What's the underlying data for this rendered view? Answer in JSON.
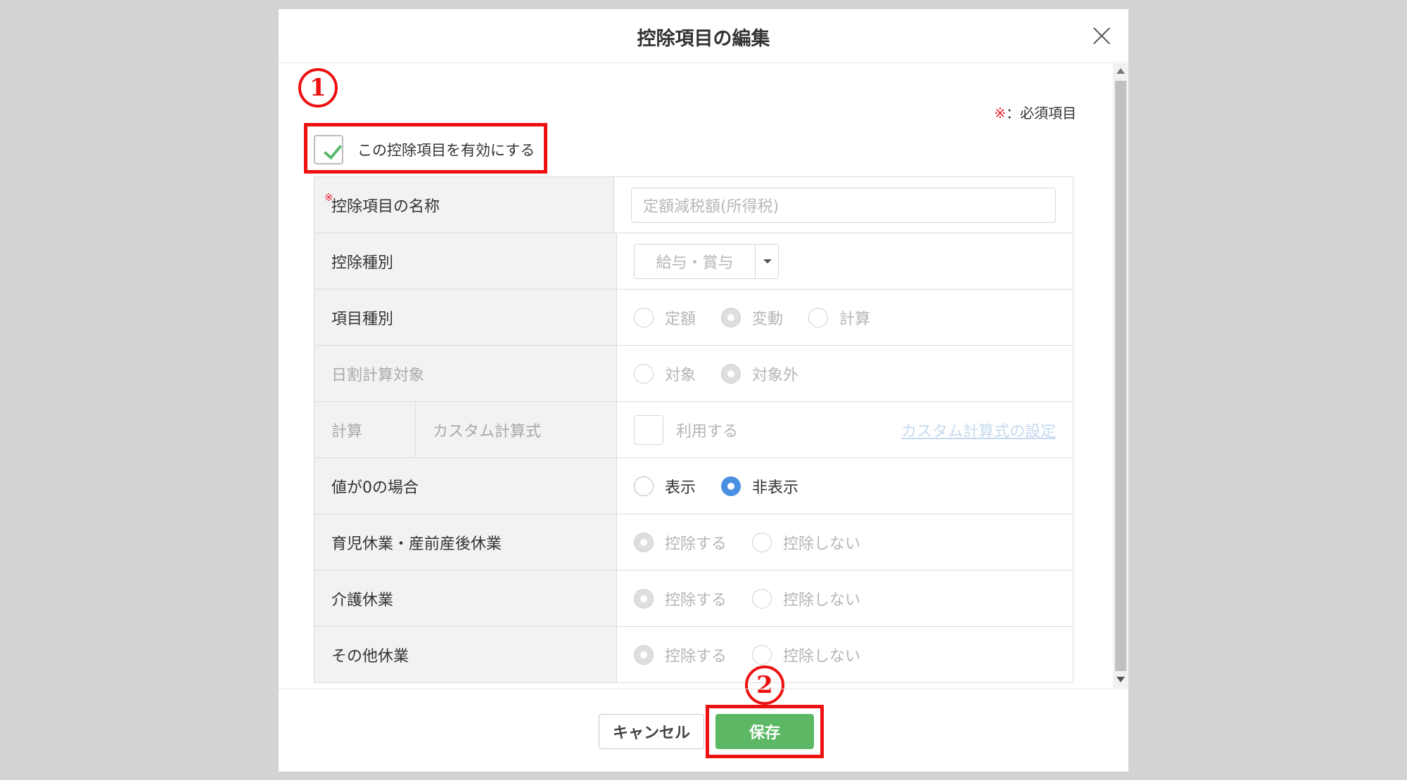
{
  "modal": {
    "title": "控除項目の編集",
    "required_note_mark": "※",
    "required_note_text": "：必須項目",
    "enable_label": "この控除項目を有効にする",
    "enable_checked": true
  },
  "annotations": {
    "step1": "1",
    "step2": "2"
  },
  "form": {
    "name": {
      "required_mark": "※",
      "label": "控除項目の名称",
      "placeholder": "定額減税額(所得税)"
    },
    "deduction_type": {
      "label": "控除種別",
      "value": "給与・賞与"
    },
    "item_type": {
      "label": "項目種別",
      "options": [
        "定額",
        "変動",
        "計算"
      ],
      "selected": "変動"
    },
    "daily_calc": {
      "label": "日割計算対象",
      "options": [
        "対象",
        "対象外"
      ],
      "selected": "対象外"
    },
    "calc": {
      "label": "計算",
      "sublabel": "カスタム計算式",
      "use_label": "利用する",
      "link": "カスタム計算式の設定"
    },
    "zero_value": {
      "label": "値が0の場合",
      "options": [
        "表示",
        "非表示"
      ],
      "selected": "非表示"
    },
    "childcare_leave": {
      "label": "育児休業・産前産後休業",
      "options": [
        "控除する",
        "控除しない"
      ],
      "selected": "控除する"
    },
    "nursing_leave": {
      "label": "介護休業",
      "options": [
        "控除する",
        "控除しない"
      ],
      "selected": "控除する"
    },
    "other_leave": {
      "label": "その他休業",
      "options": [
        "控除する",
        "控除しない"
      ],
      "selected": "控除する"
    }
  },
  "footer": {
    "cancel_label": "キャンセル",
    "save_label": "保存"
  },
  "colors": {
    "annotation_red": "#ee1111",
    "save_green": "#5cb865",
    "radio_active_blue": "#4a90e2",
    "check_green": "#58b86c"
  }
}
